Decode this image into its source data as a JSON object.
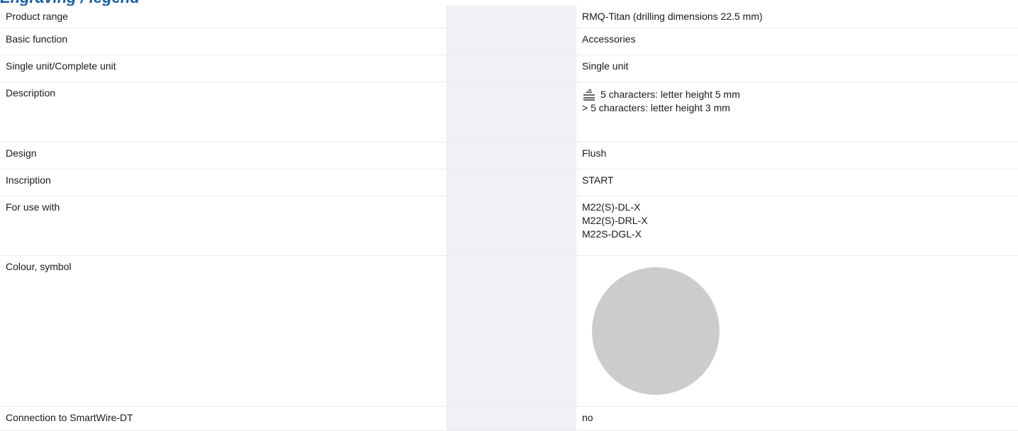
{
  "heading": {
    "text": "Engraving / legend"
  },
  "rows": [
    {
      "label": "Product range",
      "value": "RMQ-Titan (drilling dimensions 22.5 mm)"
    },
    {
      "label": "Basic function",
      "value": "Accessories"
    },
    {
      "label": "Single unit/Complete unit",
      "value": "Single unit"
    },
    {
      "label": "Description",
      "lines": [
        "5 characters: letter height 5 mm",
        "> 5 characters: letter height 3 mm"
      ]
    },
    {
      "label": "Design",
      "value": "Flush"
    },
    {
      "label": "Inscription",
      "value": "START"
    },
    {
      "label": "For use with",
      "lines": [
        "M22(S)-DL-X",
        "M22(S)-DRL-X",
        "M22S-DGL-X"
      ]
    },
    {
      "label": "Colour, symbol",
      "swatch_color": "#cccccc"
    },
    {
      "label": "Connection to SmartWire-DT",
      "value": "no"
    }
  ]
}
